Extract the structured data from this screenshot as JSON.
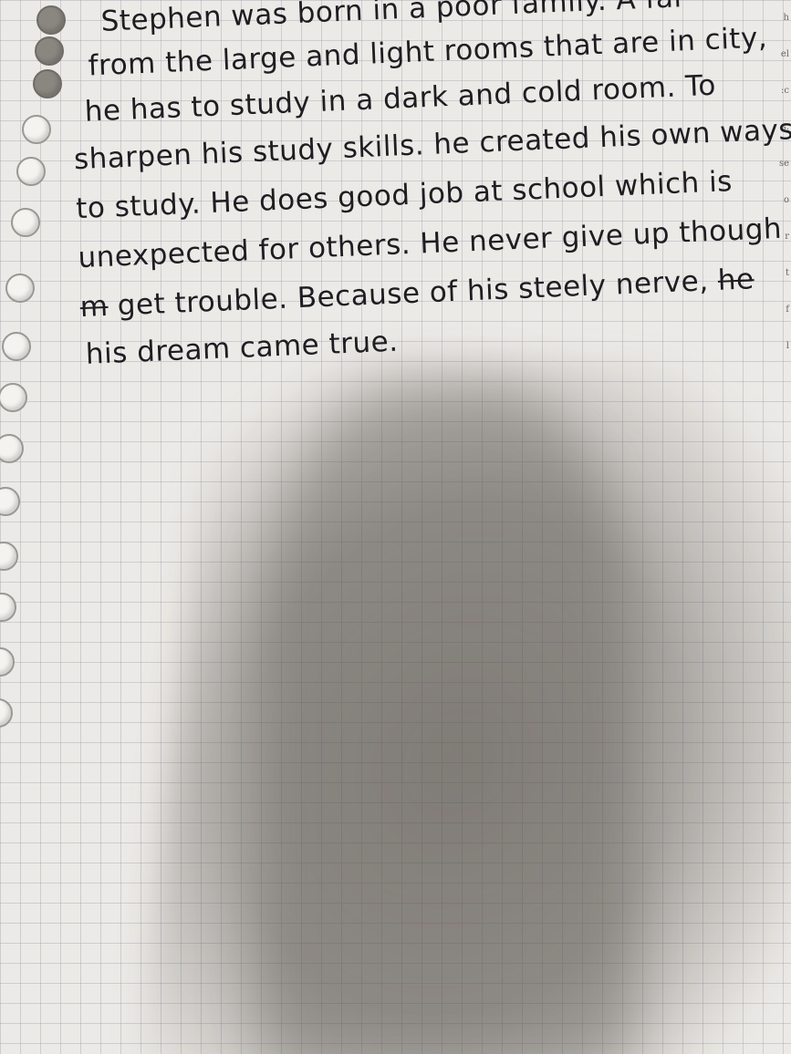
{
  "note": {
    "lines": [
      "Stephen was born in a poor family. A far",
      "from the large and light rooms that are in city,",
      "he has to study in a dark and cold room. To",
      "sharpen his study skills. he created his own ways",
      "to study. He does good job at school which is",
      "unexpected for others. He never give up though",
      "get trouble. Because of his steely nerve,",
      "his dream came true."
    ],
    "struck_prefix": "m",
    "struck_suffix": "he"
  },
  "colors": {
    "ink": "#1e1d22",
    "paper": "#eceae6",
    "grid": "#9696a5"
  }
}
